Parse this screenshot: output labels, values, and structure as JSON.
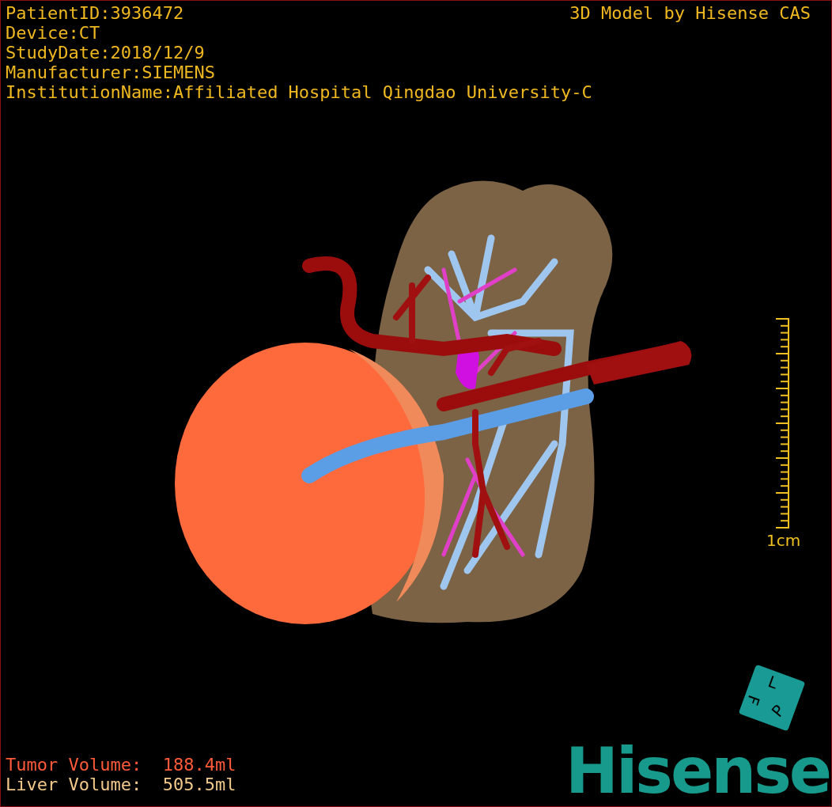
{
  "study_info": [
    "PatientID:3936472",
    "Device:CT",
    "StudyDate:2018/12/9",
    "Manufacturer:SIEMENS",
    "InstitutionName:Affiliated Hospital Qingdao University-C"
  ],
  "credit": "3D Model by Hisense CAS",
  "scale_bar": {
    "label": "1cm"
  },
  "orientation_cube": {
    "faces": [
      "L",
      "P",
      "F"
    ]
  },
  "volumes": [
    {
      "text": "Tumor Volume:  188.4ml",
      "color": "#ff5a3a"
    },
    {
      "text": "Liver Volume:  505.5ml",
      "color": "#f2c98a"
    }
  ],
  "logo": "Hisense"
}
